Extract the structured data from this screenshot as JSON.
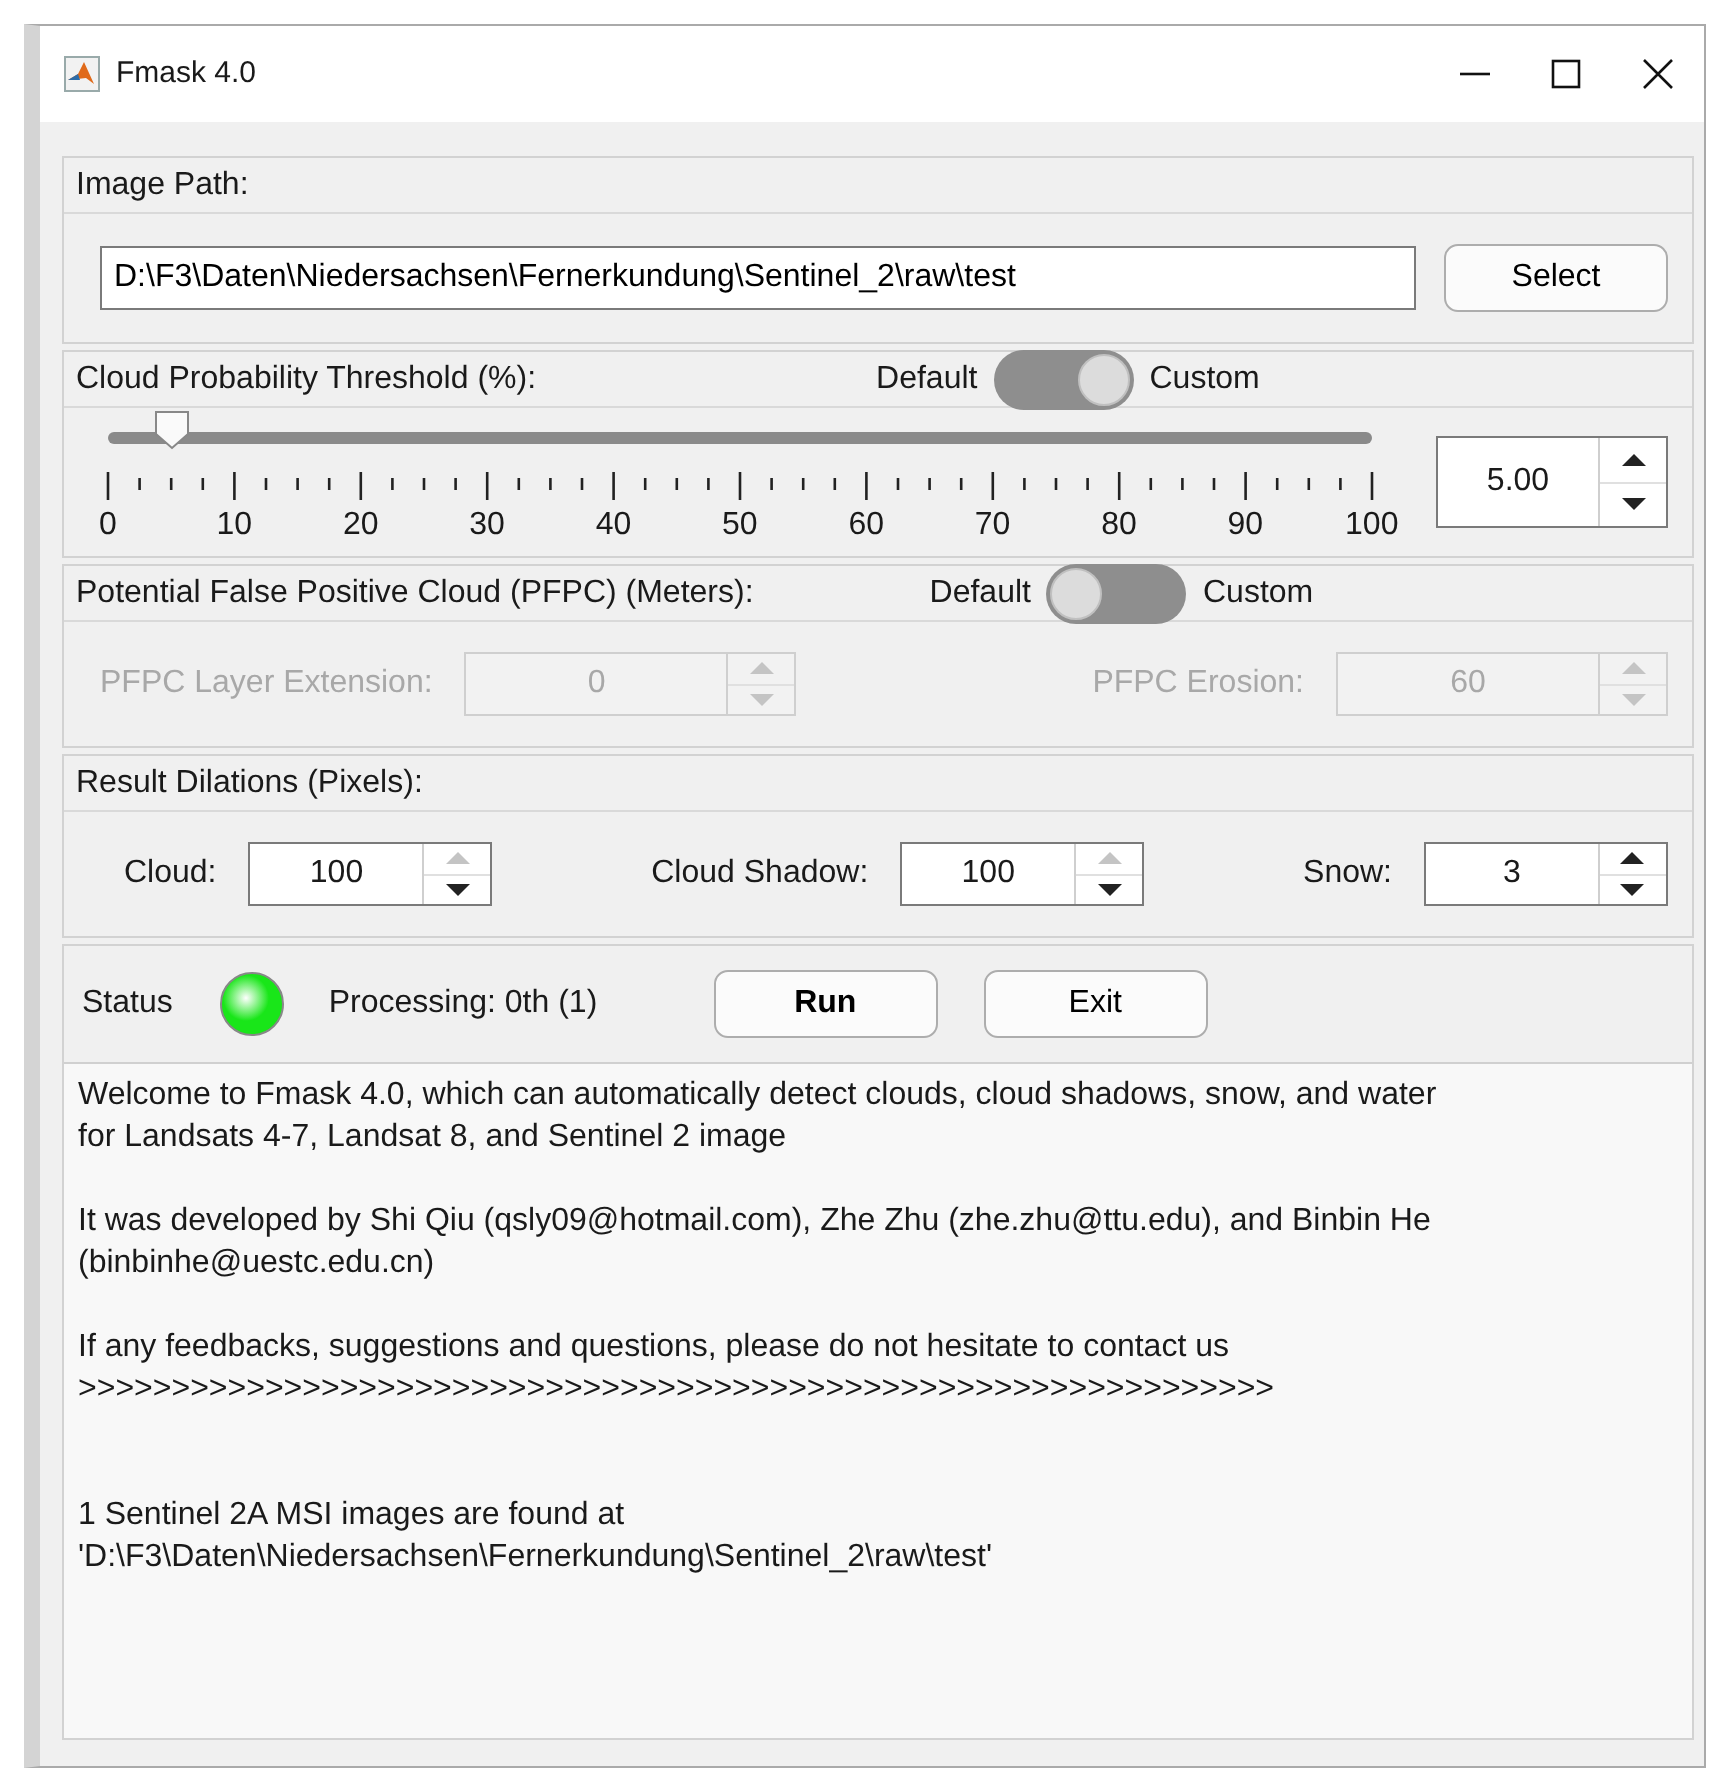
{
  "window": {
    "title": "Fmask 4.0"
  },
  "image_path": {
    "label": "Image Path:",
    "value": "D:\\F3\\Daten\\Niedersachsen\\Fernerkundung\\Sentinel_2\\raw\\test",
    "button": "Select"
  },
  "cloud_probability": {
    "label": "Cloud Probability Threshold (%):",
    "toggle": {
      "off_label": "Default",
      "on_label": "Custom",
      "on": true
    },
    "slider": {
      "level": 0.05,
      "tick_labels": [
        "0",
        "10",
        "20",
        "30",
        "40",
        "50",
        "60",
        "70",
        "80",
        "90",
        "100"
      ]
    },
    "spinner": {
      "value": "5.00",
      "disabled": false,
      "up_enabled": true,
      "down_enabled": true
    }
  },
  "pfpc": {
    "label": "Potential False Positive Cloud (PFPC) (Meters):",
    "toggle": {
      "off_label": "Default",
      "on_label": "Custom",
      "on": false
    },
    "fields": [
      {
        "label": "PFPC Layer Extension:",
        "value": "0",
        "disabled": true,
        "up_enabled": false,
        "down_enabled": false
      },
      {
        "label": "PFPC Erosion:",
        "value": "60",
        "disabled": true,
        "up_enabled": false,
        "down_enabled": false
      }
    ]
  },
  "dilations": {
    "label": "Result Dilations (Pixels):",
    "fields": [
      {
        "label": "Cloud:",
        "value": "100",
        "disabled": false,
        "up_enabled": false,
        "down_enabled": true
      },
      {
        "label": "Cloud Shadow:",
        "value": "100",
        "disabled": false,
        "up_enabled": false,
        "down_enabled": true
      },
      {
        "label": "Snow:",
        "value": "3",
        "disabled": false,
        "up_enabled": true,
        "down_enabled": true
      }
    ]
  },
  "status": {
    "label": "Status",
    "lamp": {
      "color": "#19e619"
    },
    "message": "Processing: 0th (1)",
    "buttons": [
      "Run",
      "Exit"
    ]
  },
  "log": [
    {
      "kind": "message",
      "lines": [
        "Welcome to Fmask 4.0, which can automatically detect clouds, cloud shadows, snow, and water",
        "for Landsats 4-7, Landsat 8, and Sentinel 2 image"
      ]
    },
    {
      "kind": "message",
      "lines": [
        "It was developed by Shi Qiu (qsly09@hotmail.com), Zhe Zhu (zhe.zhu@ttu.edu), and Binbin He",
        "(binbinhe@uestc.edu.cn)"
      ]
    },
    {
      "kind": "message",
      "lines": [
        "If any feedbacks, suggestions and questions, please do not hesitate to contact us",
        ">>>>>>>>>>>>>>>>>>>>>>>>>>>>>>>>>>>>>>>>>>>>>>>>>>>>>>>>>>>>>>>>"
      ]
    },
    {
      "kind": "result",
      "lines": [
        "1 Sentinel 2A MSI images are found at",
        "'D:\\F3\\Daten\\Niedersachsen\\Fernerkundung\\Sentinel_2\\raw\\test'"
      ]
    }
  ]
}
